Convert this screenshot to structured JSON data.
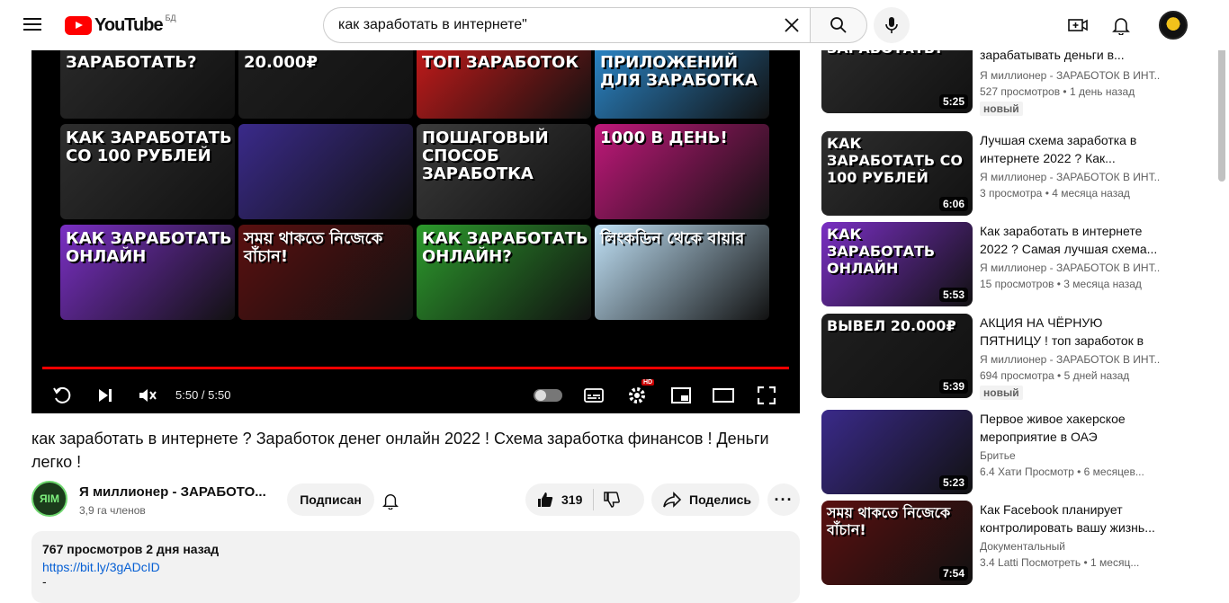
{
  "header": {
    "logo_text": "YouTube",
    "region": "БД",
    "search_value": "как заработать в интернете\""
  },
  "player": {
    "time": "5:50 / 5:50",
    "hd": "HD",
    "grid": [
      {
        "text": "ЗАРАБОТАТЬ?",
        "bg": "#2b2b2b"
      },
      {
        "text": "20.000₽",
        "bg": "#1f1f1f"
      },
      {
        "text": "ТОП ЗАРАБОТОК",
        "bg": "#d11b1b"
      },
      {
        "text": "ПРИЛОЖЕНИЙ ДЛЯ ЗАРАБОТКА",
        "bg": "#2d8fd6"
      },
      {
        "text": "КАК ЗАРАБОТАТЬ СО 100 РУБЛЕЙ",
        "bg": "#2e2e2e"
      },
      {
        "text": "",
        "bg": "#3a2a8a"
      },
      {
        "text": "ПОШАГОВЫЙ СПОСОБ ЗАРАБОТКА",
        "bg": "#3b3b3b"
      },
      {
        "text": "1000 В ДЕНЬ!",
        "bg": "#c0187a"
      },
      {
        "text": "КАК ЗАРАБОТАТЬ ОНЛАЙН",
        "bg": "#7a2fc4"
      },
      {
        "text": "সময় থাকতে নিজেকে বাঁচান!",
        "bg": "#5a1010"
      },
      {
        "text": "КАК ЗАРАБОТАТЬ ОНЛАЙН?",
        "bg": "#2c9a2c"
      },
      {
        "text": "লিংকডিন থেকে বায়ার",
        "bg": "#bfe0f5"
      }
    ]
  },
  "video": {
    "title": "как заработать в интернете ? Заработок денег онлайн 2022 ! Схема заработка финансов ! Деньги легко !",
    "channel_name": "Я миллионер - ЗАРАБОТО...",
    "channel_avatar_text": "ЯIM",
    "subscribers": "3,9 га членов",
    "subscribe_label": "Подписан",
    "likes": "319",
    "share_label": "Поделись",
    "more_label": "···",
    "description_meta": "767 просмотров 2 дня назад",
    "description_link": "https://bit.ly/3gADcID",
    "description_more": "-"
  },
  "sidebar": {
    "items": [
      {
        "thumb_text": "ЗАРАБОТАТЬ?",
        "bg": "#2b2b2b",
        "duration": "5:25",
        "title": "зарабатывать деньги в...",
        "channel": "Я миллионер - ЗАРАБОТОК В ИНТ...",
        "meta": "527 просмотров  • 1 день назад",
        "badge": "новый"
      },
      {
        "thumb_text": "КАК ЗАРАБОТАТЬ СО 100 РУБЛЕЙ",
        "bg": "#2e2e2e",
        "duration": "6:06",
        "title": "Лучшая схема заработка в интернете 2022 ? Как...",
        "channel": "Я миллионер - ЗАРАБОТОК В ИНТ...",
        "meta": "3 просмотра  • 4 месяца назад",
        "badge": ""
      },
      {
        "thumb_text": "КАК ЗАРАБОТАТЬ ОНЛАЙН",
        "bg": "#7a2fc4",
        "duration": "5:53",
        "title": "Как заработать в интернете 2022 ? Самая лучшая схема...",
        "channel": "Я миллионер - ЗАРАБОТОК В ИНТ...",
        "meta": "15 просмотров  • 3 месяца назад",
        "badge": ""
      },
      {
        "thumb_text": "ВЫВЕЛ 20.000₽",
        "bg": "#1f1f1f",
        "duration": "5:39",
        "title": "АКЦИЯ НА ЧЁРНУЮ ПЯТНИЦУ ! топ заработок в интернете!...",
        "channel": "Я миллионер - ЗАРАБОТОК В ИНТ...",
        "meta": "694 просмотра  • 5 дней назад",
        "badge": "новый"
      },
      {
        "thumb_text": "",
        "bg": "#3a2a8a",
        "duration": "5:23",
        "title": "Первое живое хакерское мероприятие в ОАЭ",
        "channel": "Бритье",
        "meta": "6.4 Хати Просмотр  • 6 месяцев...",
        "badge": ""
      },
      {
        "thumb_text": "সময় থাকতে নিজেকে বাঁচান!",
        "bg": "#5a1010",
        "duration": "7:54",
        "title": "Как Facebook планирует контролировать вашу жизнь...",
        "channel": "Документальный",
        "meta": "3.4 Latti Посмотреть  • 1 месяц...",
        "badge": ""
      }
    ]
  }
}
